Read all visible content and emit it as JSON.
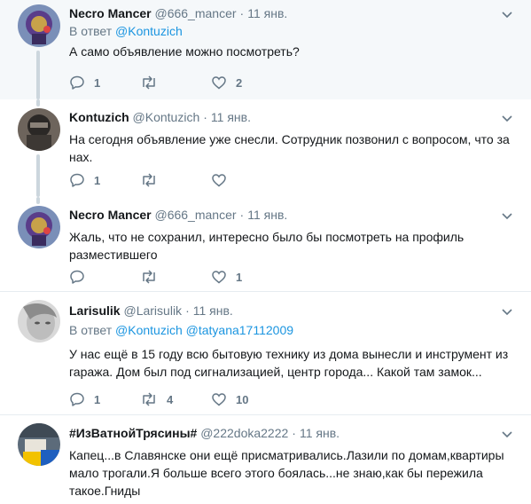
{
  "tweets": [
    {
      "name": "Necro Mancer",
      "handle": "@666_mancer",
      "time": "11 янв.",
      "reply_prefix": "В ответ",
      "reply_to": "@Kontuzich",
      "text": "А само объявление можно посмотреть?",
      "counts": {
        "reply": "1",
        "retweet": "",
        "like": "2"
      }
    },
    {
      "name": "Kontuzich",
      "handle": "@Kontuzich",
      "time": "11 янв.",
      "text": "На сегодня объявление уже снесли. Сотрудник позвонил с вопросом, что за нах.",
      "counts": {
        "reply": "1",
        "retweet": "",
        "like": ""
      }
    },
    {
      "name": "Necro Mancer",
      "handle": "@666_mancer",
      "time": "11 янв.",
      "text": "Жаль, что не сохранил, интересно было бы посмотреть на профиль разместившего",
      "counts": {
        "reply": "",
        "retweet": "",
        "like": "1"
      }
    },
    {
      "name": "Larisulik",
      "handle": "@Larisulik",
      "time": "11 янв.",
      "reply_prefix": "В ответ",
      "reply_to": "@Kontuzich",
      "reply_to_2": "@tatyana17112009",
      "text": "У нас ещё в 15 году всю бытовую технику из дома вынесли и инструмент из гаража. Дом был под сигнализацией, центр города... Какой там замок...",
      "counts": {
        "reply": "1",
        "retweet": "4",
        "like": "10"
      }
    },
    {
      "name": "#ИзВатнойТрясины#",
      "handle": "@222doka2222",
      "time": "11 янв.",
      "text": "Капец...в Славянске они ещё присматривались.Лазили по домам,квартиры мало трогали.Я больше всего этого боялась...не знаю,как бы пережила такое.Гниды",
      "counts": {
        "reply": "",
        "retweet": "",
        "like": ""
      }
    }
  ],
  "colors": {
    "accent": "#1b95e0",
    "secondary": "#657786",
    "highlight_bg": "#f5f8fa",
    "border": "#e6ecf0",
    "thread_line": "#ccd6dd"
  },
  "icons": {
    "reply": "reply-icon",
    "retweet": "retweet-icon",
    "like": "heart-icon",
    "more": "chevron-down-icon"
  }
}
